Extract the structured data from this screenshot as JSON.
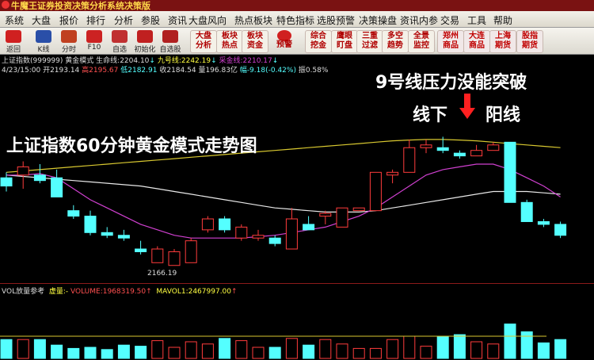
{
  "window_title": "牛魔王证券投资决策分析系统决策版",
  "menu": [
    "系统",
    "大盘",
    "报价",
    "排行",
    "分析",
    "参股",
    "资讯",
    "大盘风向",
    "热点板块",
    "特色指标",
    "选股预警",
    "决策操盘",
    "资讯内参",
    "交易",
    "工具",
    "帮助"
  ],
  "toolbar": {
    "icons": [
      {
        "label": "返回",
        "icon": "return-icon",
        "color": "#d02020"
      },
      {
        "label": "K线",
        "icon": "kline-icon",
        "color": "#2a4fa8"
      },
      {
        "label": "分时",
        "icon": "timeshare-icon",
        "color": "#c04020"
      },
      {
        "label": "F10",
        "icon": "f10-icon",
        "color": "#cc2222"
      },
      {
        "label": "自选",
        "icon": "watchlist-icon",
        "color": "#c03030"
      },
      {
        "label": "初始化",
        "icon": "init-icon",
        "color": "#c02020"
      },
      {
        "label": "自选股",
        "icon": "stock-pool-icon",
        "color": "#b02020"
      }
    ],
    "groups": [
      [
        "大盘",
        "分析"
      ],
      [
        "板块",
        "热点"
      ],
      [
        "板块",
        "资金"
      ],
      [
        "预警"
      ],
      [
        "综合",
        "挖金"
      ],
      [
        "鹰眼",
        "盯盘"
      ],
      [
        "三重",
        "过滤"
      ],
      [
        "多空",
        "趋势"
      ],
      [
        "全景",
        "监控"
      ],
      [
        "郑州",
        "商品"
      ],
      [
        "大连",
        "商品"
      ],
      [
        "上海",
        "期货"
      ],
      [
        "股指",
        "期货"
      ]
    ]
  },
  "header": {
    "index_name": "上证指数(999999)",
    "mode": "黄金模式",
    "life_line": "生命线:2204.10",
    "life_arrow": "↓",
    "nine_line": "九号线:2242.19",
    "nine_arrow": "↓",
    "ma_line": "采金线:2210.17",
    "ma_arrow": "↓",
    "date": "4/23/15:00",
    "open": "开2193.14",
    "high": "高2195.67",
    "low": "低2182.91",
    "close": "收2184.54",
    "volume": "量196.83亿",
    "change": "幅-9.18(-0.42%)",
    "amp": "振0.58%"
  },
  "annotations": {
    "title": "上证指数60分钟黄金模式走势图",
    "resistance": "9号线压力没能突破",
    "below": "线下",
    "yang": "阳线",
    "low_label": "2166.19"
  },
  "volume_header": {
    "name": "VOL放量参考",
    "vline": "虚量:-",
    "volume": "VOLUME:1968319.50",
    "volume_arrow": "↑",
    "mavol": "MAVOL1:2467997.00",
    "mavol_arrow": "↑"
  },
  "colors": {
    "up": "#ff3c3c",
    "down": "#54ffff",
    "gold": "#d8c830",
    "magenta": "#d040d0",
    "white": "#e8e8e8"
  },
  "chart_data": {
    "type": "candlestick",
    "candles": [
      {
        "o": 2197,
        "h": 2199,
        "l": 2192,
        "c": 2194
      },
      {
        "o": 2198,
        "h": 2203,
        "l": 2193,
        "c": 2201
      },
      {
        "o": 2198,
        "h": 2202,
        "l": 2195,
        "c": 2196
      },
      {
        "o": 2197,
        "h": 2200,
        "l": 2190,
        "c": 2190
      },
      {
        "o": 2185,
        "h": 2187,
        "l": 2182,
        "c": 2183
      },
      {
        "o": 2183,
        "h": 2185,
        "l": 2176,
        "c": 2177
      },
      {
        "o": 2177,
        "h": 2179,
        "l": 2175,
        "c": 2176
      },
      {
        "o": 2176,
        "h": 2178,
        "l": 2174,
        "c": 2175
      },
      {
        "o": 2171,
        "h": 2174,
        "l": 2169,
        "c": 2170
      },
      {
        "o": 2166,
        "h": 2172,
        "l": 2166,
        "c": 2171
      },
      {
        "o": 2165,
        "h": 2171,
        "l": 2165,
        "c": 2170
      },
      {
        "o": 2166,
        "h": 2175,
        "l": 2166,
        "c": 2174
      },
      {
        "o": 2178,
        "h": 2183,
        "l": 2177,
        "c": 2182
      },
      {
        "o": 2182,
        "h": 2183,
        "l": 2177,
        "c": 2178
      },
      {
        "o": 2175,
        "h": 2180,
        "l": 2174,
        "c": 2179
      },
      {
        "o": 2175,
        "h": 2178,
        "l": 2174,
        "c": 2176
      },
      {
        "o": 2175,
        "h": 2176,
        "l": 2172,
        "c": 2173
      },
      {
        "o": 2171,
        "h": 2186,
        "l": 2171,
        "c": 2182
      },
      {
        "o": 2180,
        "h": 2183,
        "l": 2178,
        "c": 2178
      },
      {
        "o": 2183,
        "h": 2185,
        "l": 2180,
        "c": 2184
      },
      {
        "o": 2179,
        "h": 2186,
        "l": 2179,
        "c": 2186
      },
      {
        "o": 2185,
        "h": 2186,
        "l": 2185,
        "c": 2186
      },
      {
        "o": 2185,
        "h": 2199,
        "l": 2185,
        "c": 2199
      },
      {
        "o": 2198,
        "h": 2200,
        "l": 2195,
        "c": 2199
      },
      {
        "o": 2199,
        "h": 2211,
        "l": 2199,
        "c": 2208
      },
      {
        "o": 2208,
        "h": 2211,
        "l": 2206,
        "c": 2209
      },
      {
        "o": 2208,
        "h": 2212,
        "l": 2206,
        "c": 2207
      },
      {
        "o": 2206,
        "h": 2207,
        "l": 2204,
        "c": 2205
      },
      {
        "o": 2205,
        "h": 2209,
        "l": 2205,
        "c": 2207
      },
      {
        "o": 2207,
        "h": 2210,
        "l": 2207,
        "c": 2209
      },
      {
        "o": 2210,
        "h": 2210,
        "l": 2188,
        "c": 2188
      },
      {
        "o": 2188,
        "h": 2189,
        "l": 2181,
        "c": 2181
      },
      {
        "o": 2181,
        "h": 2182,
        "l": 2179,
        "c": 2180
      },
      {
        "o": 2180,
        "h": 2181,
        "l": 2175,
        "c": 2176
      }
    ],
    "nine_line": [
      2199,
      2199.5,
      2200,
      2200.5,
      2201,
      2201.5,
      2202,
      2202.5,
      2203,
      2203.5,
      2204,
      2204.5,
      2205,
      2205.5,
      2206,
      2206.5,
      2207,
      2207.5,
      2208,
      2208.5,
      2209,
      2209.5,
      2210,
      2210.5,
      2210.8,
      2211,
      2211,
      2210.8,
      2210.5,
      2210,
      2209.5,
      2209,
      2208.5,
      2208
    ],
    "life_line": [
      2198,
      2197.5,
      2197,
      2196.5,
      2196,
      2195.5,
      2195,
      2194.5,
      2194,
      2193,
      2192,
      2191,
      2190,
      2189,
      2188,
      2187,
      2186,
      2185.5,
      2185,
      2184.5,
      2184.5,
      2184.5,
      2185,
      2186,
      2187,
      2188,
      2189,
      2190,
      2191,
      2192,
      2192,
      2192,
      2191.5,
      2191
    ],
    "ma_line": [
      2198,
      2198,
      2198.5,
      2197,
      2193,
      2189,
      2186,
      2183,
      2180,
      2178,
      2176,
      2175,
      2175,
      2175,
      2175,
      2175.5,
      2176,
      2177,
      2178,
      2179,
      2181,
      2183,
      2186,
      2190,
      2194,
      2198,
      2200,
      2201,
      2202,
      2202,
      2200,
      2197,
      2194,
      2190
    ],
    "volumes": [
      0.85,
      0.85,
      0.85,
      0.6,
      0.45,
      0.5,
      0.4,
      0.6,
      0.55,
      0.8,
      0.5,
      0.75,
      0.65,
      0.9,
      0.8,
      0.5,
      0.5,
      0.9,
      0.6,
      0.85,
      0.65,
      0.45,
      0.45,
      0.85,
      1.0,
      0.55,
      1.0,
      1.07,
      0.75,
      0.65,
      1.55,
      1.2,
      0.7,
      0.85
    ],
    "vol_ma": 1.0,
    "ylim": [
      2160,
      2235
    ]
  }
}
